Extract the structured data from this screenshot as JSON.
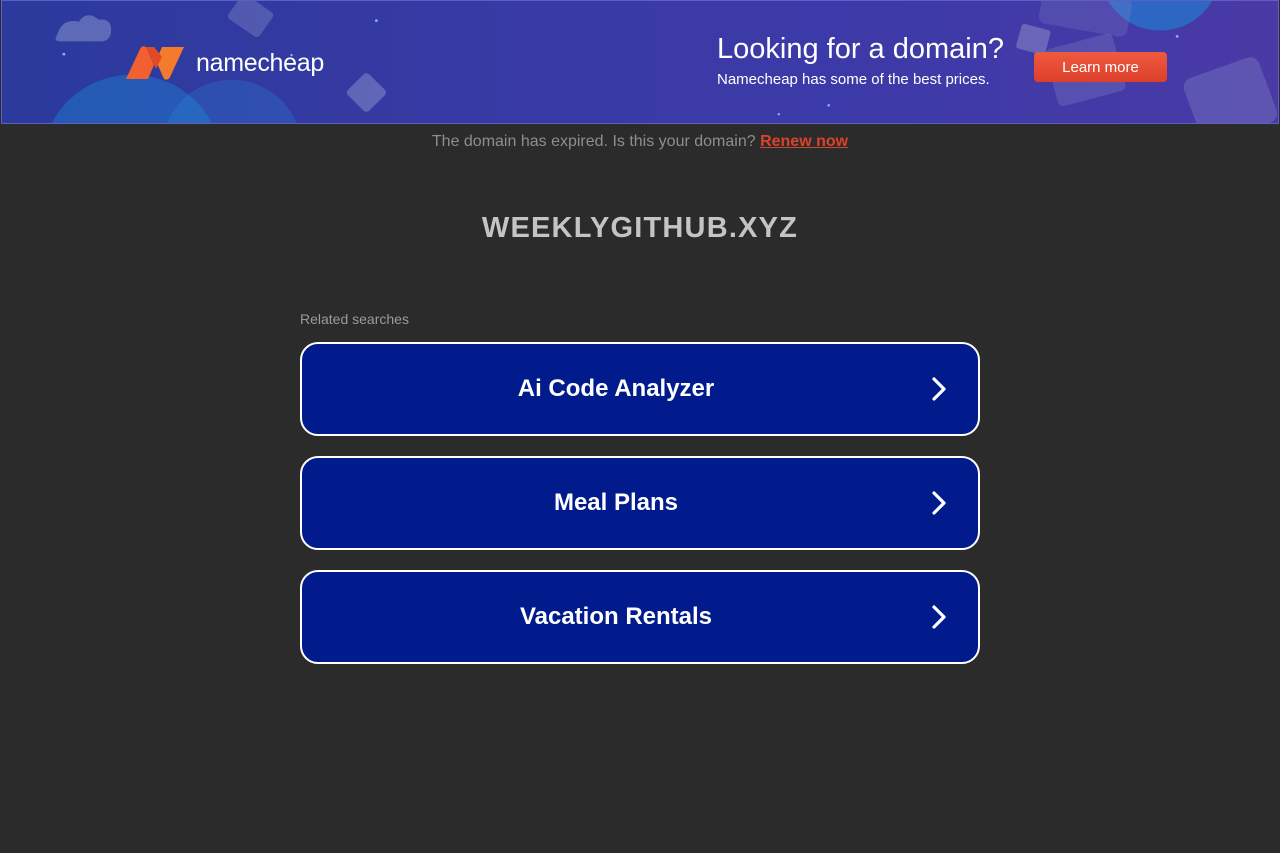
{
  "banner": {
    "brand_name": "namecheap",
    "promo_title": "Looking for a domain?",
    "promo_subtitle": "Namecheap has some of the best prices.",
    "cta_label": "Learn more",
    "colors": {
      "logo_orange": "#f5602e",
      "cta": "#e2462f",
      "background": "#3a3aa6"
    }
  },
  "notice": {
    "text": "The domain has expired. Is this your domain?",
    "link_label": "Renew now"
  },
  "domain": {
    "name": "WEEKLYGITHUB.XYZ"
  },
  "related": {
    "heading": "Related searches",
    "items": [
      {
        "label": "Ai Code Analyzer",
        "icon": "chevron-right-icon"
      },
      {
        "label": "Meal Plans",
        "icon": "chevron-right-icon"
      },
      {
        "label": "Vacation Rentals",
        "icon": "chevron-right-icon"
      }
    ]
  }
}
